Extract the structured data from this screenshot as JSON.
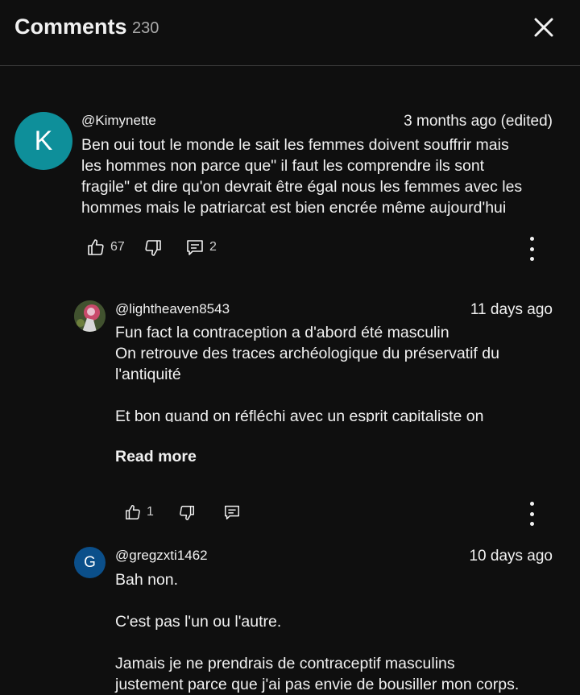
{
  "header": {
    "title": "Comments",
    "count": "230"
  },
  "comments": [
    {
      "author": "@Kimynette",
      "time": "3 months ago (edited)",
      "avatar_letter": "K",
      "avatar_color": "#0e8f9a",
      "text": "Ben oui tout le monde le sait les femmes doivent souffrir mais\nles hommes non parce que\" il faut les comprendre ils sont\nfragile\" et dire qu'on devrait être égal nous les femmes avec les\nhommes mais le patriarcat est bien encrée même aujourd'hui",
      "likes": "67",
      "replies": "2"
    },
    {
      "author": "@lightheaven8543",
      "time": "11 days ago",
      "text": "Fun fact la contraception a d'abord été masculin\nOn retrouve des traces archéologique du préservatif du\nl'antiquité\n\nEt bon quand on réfléchi avec un esprit capitaliste on",
      "read_more": "Read more",
      "likes": "1"
    },
    {
      "author": "@gregzxti1462",
      "time": "10 days ago",
      "avatar_letter": "G",
      "avatar_color": "#0b4f8a",
      "text": "Bah non.\n\nC'est pas l'un ou l'autre.\n\nJamais je ne prendrais de contraceptif masculins\njustement parce que j'ai pas envie de bousiller mon corps."
    }
  ]
}
